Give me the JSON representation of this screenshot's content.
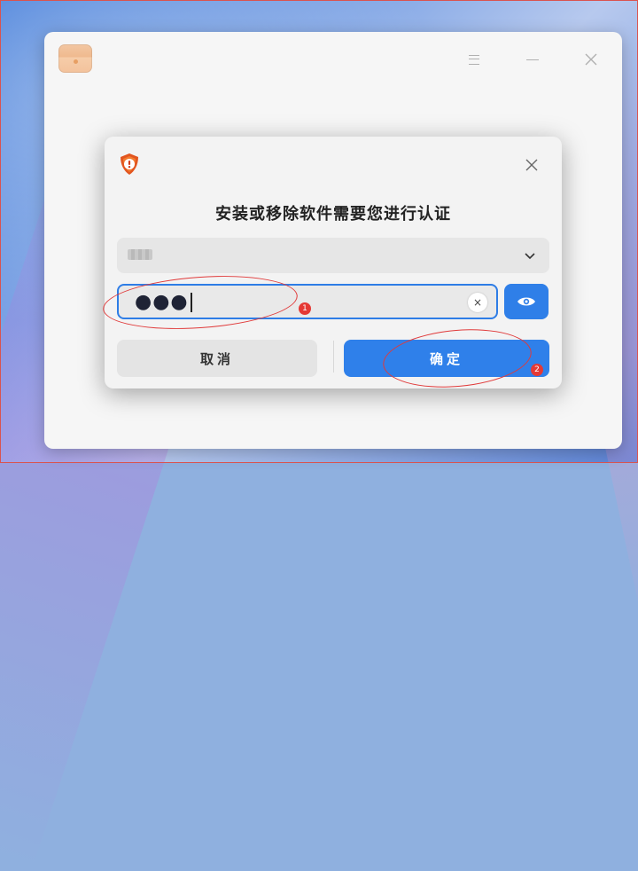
{
  "dialog": {
    "title": "安装或移除软件需要您进行认证",
    "user_name": "•••",
    "password_value": "●●●",
    "clear_glyph": "×",
    "close_glyph": "✕",
    "cancel_label": "取消",
    "confirm_label": "确定"
  },
  "annotations": {
    "marker_1": "1",
    "marker_2": "2"
  },
  "icons": {
    "app": "package-icon",
    "menu": "menu-icon",
    "minimize": "minimize-icon",
    "close": "close-icon",
    "auth": "shield-icon",
    "dropdown": "chevron-down-icon",
    "clear": "clear-icon",
    "reveal": "eye-icon"
  },
  "colors": {
    "accent": "#2f80ea",
    "shield": "#e2551f",
    "annotation": "#e53935"
  }
}
